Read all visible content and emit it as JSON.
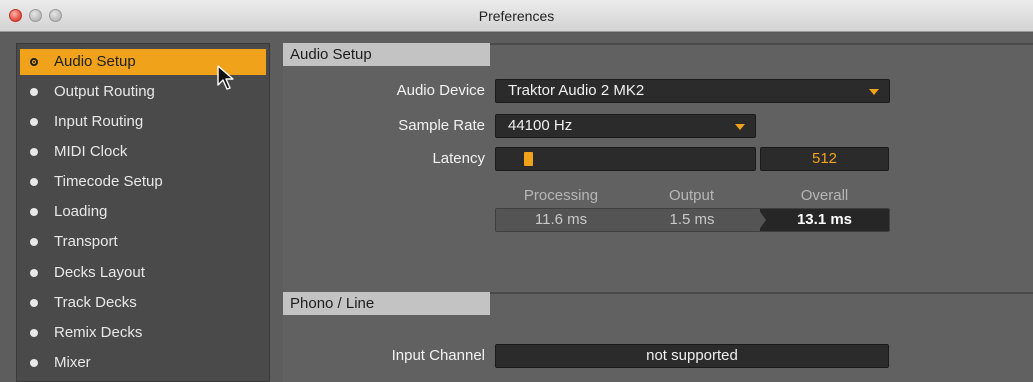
{
  "window": {
    "title": "Preferences"
  },
  "sidebar": {
    "items": [
      {
        "label": "Audio Setup",
        "selected": true
      },
      {
        "label": "Output Routing"
      },
      {
        "label": "Input Routing"
      },
      {
        "label": "MIDI Clock"
      },
      {
        "label": "Timecode Setup"
      },
      {
        "label": "Loading"
      },
      {
        "label": "Transport"
      },
      {
        "label": "Decks Layout"
      },
      {
        "label": "Track Decks"
      },
      {
        "label": "Remix Decks"
      },
      {
        "label": "Mixer"
      }
    ]
  },
  "audio_setup": {
    "header": "Audio Setup",
    "audio_device_label": "Audio Device",
    "audio_device_value": "Traktor Audio 2 MK2",
    "sample_rate_label": "Sample Rate",
    "sample_rate_value": "44100 Hz",
    "latency_label": "Latency",
    "latency_value": "512",
    "columns": {
      "processing": "Processing",
      "output": "Output",
      "overall": "Overall"
    },
    "timings": {
      "processing": "11.6 ms",
      "output": "1.5 ms",
      "overall": "13.1 ms"
    }
  },
  "phono_line": {
    "header": "Phono / Line",
    "input_channel_label": "Input Channel",
    "input_channel_value": "not supported"
  },
  "colors": {
    "accent": "#f0a31a",
    "sidebar_bg": "#4a4a4a",
    "panel_bg": "#616161"
  }
}
